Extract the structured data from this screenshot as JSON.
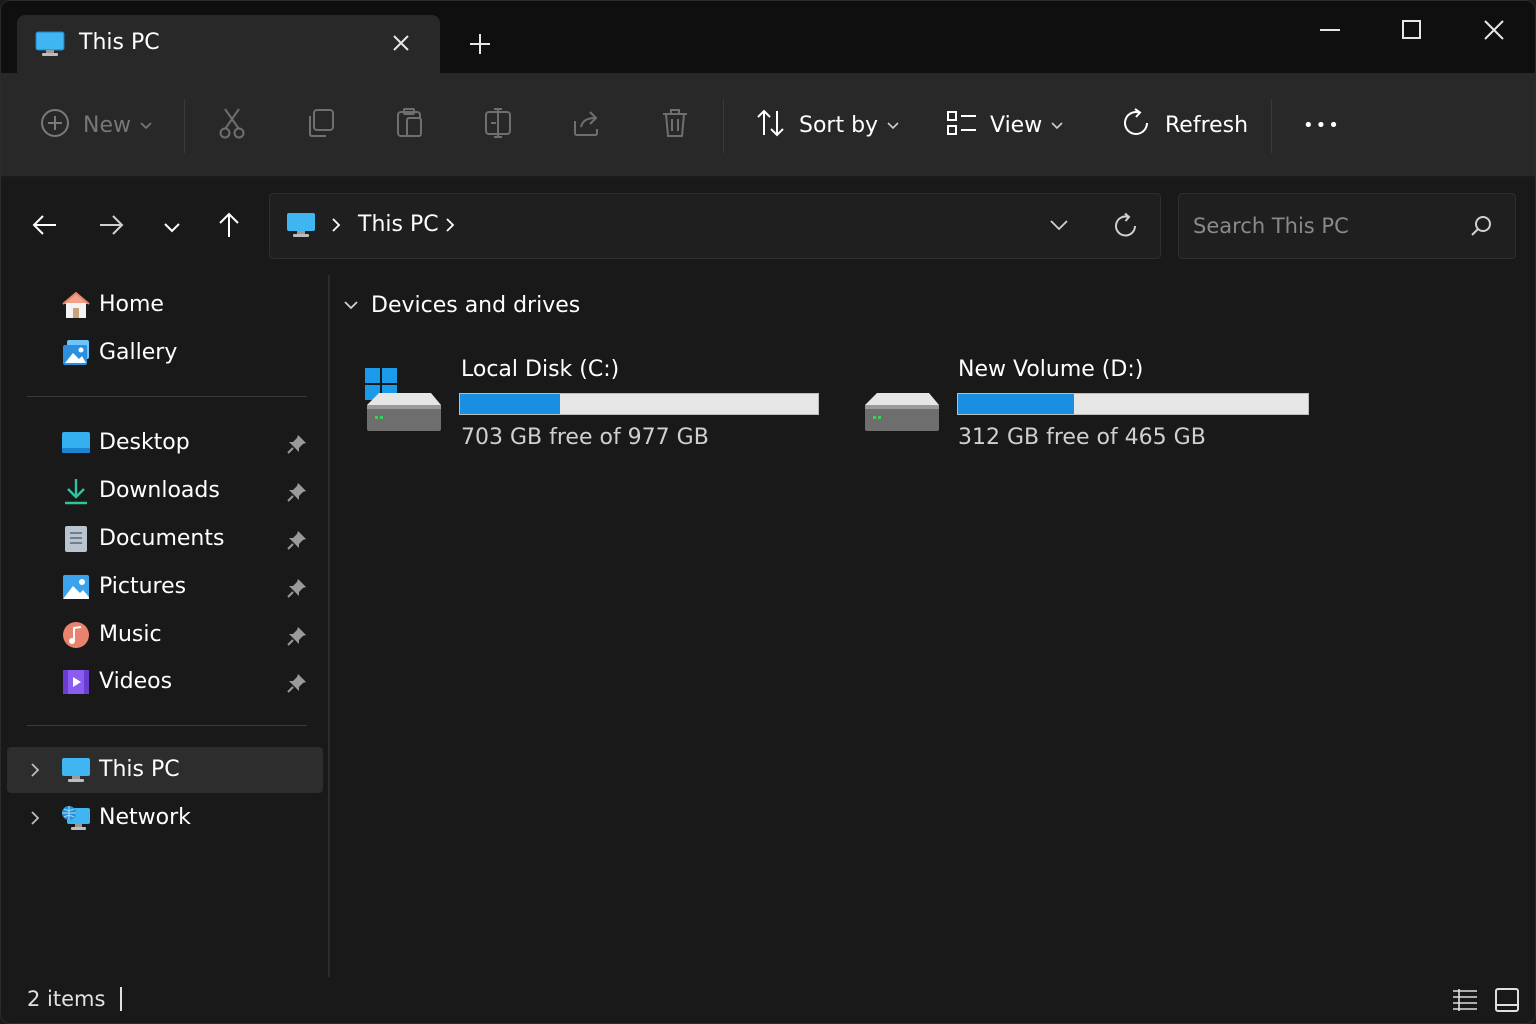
{
  "window": {
    "tab_title": "This PC",
    "new_tab_label": "+"
  },
  "toolbar": {
    "new_label": "New",
    "sort_label": "Sort by",
    "view_label": "View",
    "refresh_label": "Refresh",
    "more_label": "•••"
  },
  "address": {
    "location": "This PC",
    "search_placeholder": "Search This PC"
  },
  "sidebar": {
    "quick": [
      {
        "label": "Home",
        "icon": "home-icon"
      },
      {
        "label": "Gallery",
        "icon": "gallery-icon"
      }
    ],
    "pinned": [
      {
        "label": "Desktop",
        "icon": "desktop-icon"
      },
      {
        "label": "Downloads",
        "icon": "downloads-icon"
      },
      {
        "label": "Documents",
        "icon": "documents-icon"
      },
      {
        "label": "Pictures",
        "icon": "pictures-icon"
      },
      {
        "label": "Music",
        "icon": "music-icon"
      },
      {
        "label": "Videos",
        "icon": "videos-icon"
      }
    ],
    "tree": [
      {
        "label": "This PC",
        "icon": "this-pc-icon",
        "selected": true
      },
      {
        "label": "Network",
        "icon": "network-icon",
        "selected": false
      }
    ]
  },
  "content": {
    "section_title": "Devices and drives",
    "drives": [
      {
        "name": "Local Disk (C:)",
        "free_text": "703 GB free of 977 GB",
        "used_fraction": 0.28
      },
      {
        "name": "New Volume (D:)",
        "free_text": "312 GB free of 465 GB",
        "used_fraction": 0.33
      }
    ]
  },
  "status": {
    "item_count": "2 items"
  },
  "colors": {
    "accent": "#1a8ee0",
    "background": "#191919",
    "toolbar": "#282828"
  }
}
